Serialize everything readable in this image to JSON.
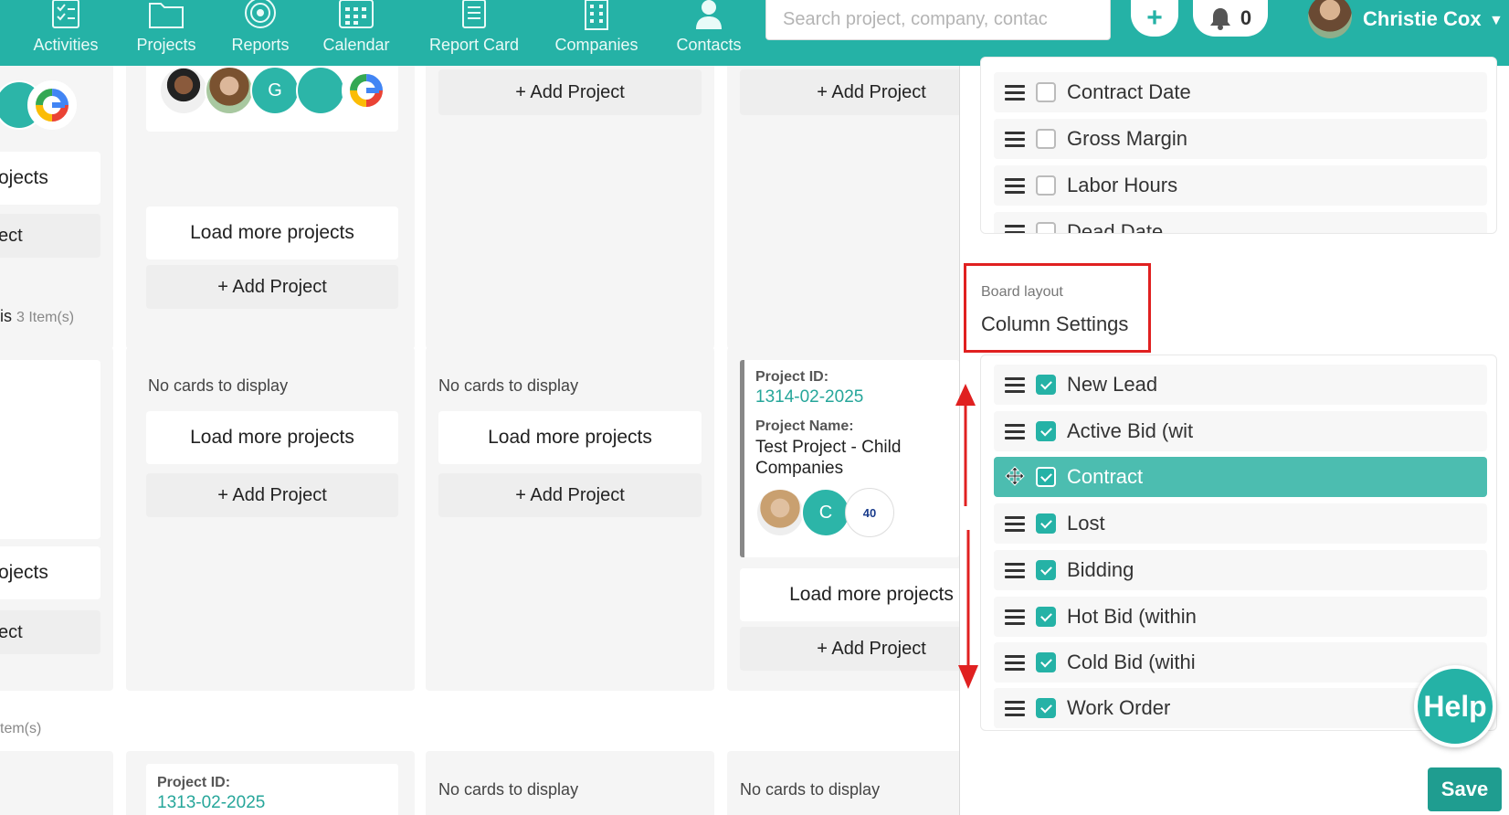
{
  "nav": {
    "items": [
      {
        "label": "Activities",
        "icon": "activities-icon"
      },
      {
        "label": "Projects",
        "icon": "projects-icon"
      },
      {
        "label": "Reports",
        "icon": "reports-icon"
      },
      {
        "label": "Calendar",
        "icon": "calendar-icon"
      },
      {
        "label": "Report Card",
        "icon": "report-card-icon"
      },
      {
        "label": "Companies",
        "icon": "companies-icon"
      },
      {
        "label": "Contacts",
        "icon": "contacts-icon"
      }
    ],
    "search_placeholder": "Search project, company, contac",
    "add_label": "+",
    "notification_count": "0",
    "user_name": "Christie Cox",
    "accent_color": "#25b2a6"
  },
  "board": {
    "load_more_label": "Load more projects",
    "add_project_label": "+ Add Project",
    "no_cards_label": "No cards to display",
    "partial_load_more": "ojects",
    "partial_add": "ect",
    "section2_label": "is",
    "section2_count": "3 Item(s)",
    "section3_count": "tem(s)",
    "avatar_letters": {
      "g": "G",
      "c": "C"
    },
    "card1": {
      "id_key": "Project ID:",
      "id": "1314-02-2025",
      "name_key": "Project Name:",
      "name": "Test Project - Child Companies",
      "logo_text": "40"
    },
    "card2": {
      "id_key": "Project ID:",
      "id": "1313-02-2025"
    }
  },
  "panel": {
    "top_items": [
      {
        "label": "Contract Date",
        "checked": false
      },
      {
        "label": "Gross Margin",
        "checked": false
      },
      {
        "label": "Labor Hours",
        "checked": false
      },
      {
        "label": "Dead Date",
        "checked": false
      }
    ],
    "board_layout_title": "Board layout",
    "column_settings_title": "Column Settings",
    "columns": [
      {
        "label": "New Lead",
        "checked": true
      },
      {
        "label": "Active Bid (wit",
        "checked": true
      },
      {
        "label": "Contract",
        "checked": true,
        "active": true
      },
      {
        "label": "Lost",
        "checked": true
      },
      {
        "label": "Bidding",
        "checked": true
      },
      {
        "label": "Hot Bid (within",
        "checked": true
      },
      {
        "label": "Cold Bid (withi",
        "checked": true
      },
      {
        "label": "Work Order",
        "checked": true
      }
    ],
    "help_label": "Help",
    "save_label": "Save"
  }
}
